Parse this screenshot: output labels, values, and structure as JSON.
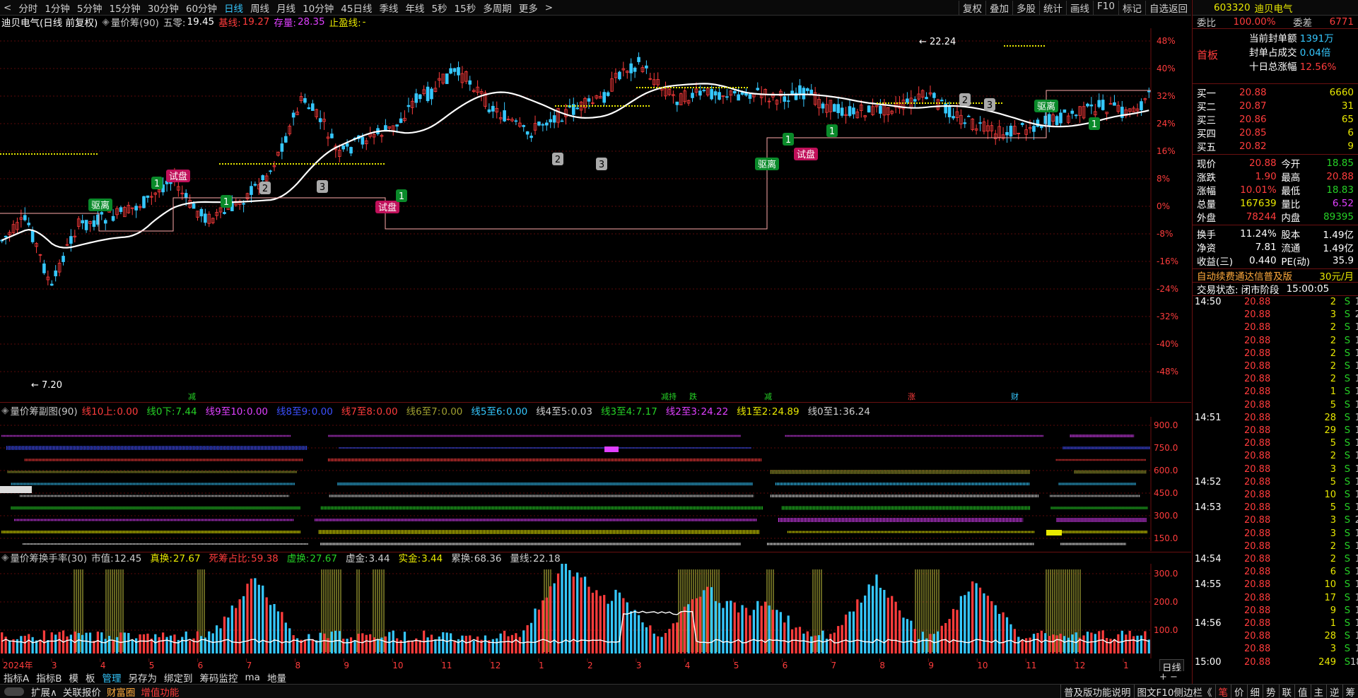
{
  "toolbar": {
    "periods": [
      "分时",
      "1分钟",
      "5分钟",
      "15分钟",
      "30分钟",
      "60分钟",
      "日线",
      "周线",
      "月线",
      "10分钟",
      "45日线",
      "季线",
      "年线",
      "5秒",
      "15秒",
      "多周期",
      "更多"
    ],
    "active": "日线",
    "right": [
      "复权",
      "叠加",
      "多股",
      "统计",
      "画线",
      "F10",
      "标记",
      "自选返回"
    ]
  },
  "main": {
    "stock_name": "迪贝电气(日线 前复权)",
    "indicator": "量价筹(90)",
    "wuling_label": "五零:",
    "wuling": "19.45",
    "jixian_label": "基线:",
    "jixian": "19.27",
    "cunliang_label": "存量:",
    "cunliang": "28.35",
    "zhiying_label": "止盈线:",
    "zhiying": "-",
    "high_label": "22.24",
    "low_label": "7.20",
    "y_axis": [
      "48%",
      "40%",
      "32%",
      "24%",
      "16%",
      "8%",
      "0%",
      "-8%",
      "-16%",
      "-24%",
      "-32%",
      "-40%",
      "-48%"
    ],
    "markers": [
      {
        "t": "驱离"
      },
      {
        "t": "试盘"
      },
      {
        "t": "1"
      },
      {
        "t": "2"
      },
      {
        "t": "3"
      },
      {
        "t": "1"
      },
      {
        "t": "试盘"
      },
      {
        "t": "1"
      },
      {
        "t": "2"
      },
      {
        "t": "3"
      },
      {
        "t": "驱离"
      },
      {
        "t": "1"
      },
      {
        "t": "试盘"
      },
      {
        "t": "1"
      },
      {
        "t": "2"
      },
      {
        "t": "3"
      },
      {
        "t": "驱离"
      },
      {
        "t": "1"
      }
    ],
    "events": [
      "减",
      "减持",
      "跌",
      "减",
      "涨",
      "财"
    ]
  },
  "sub1": {
    "title": "量价筹副图(90)",
    "items": [
      {
        "k": "线10上:",
        "v": "0.00",
        "c": "#ff3c3c"
      },
      {
        "k": "线0下:",
        "v": "7.44",
        "c": "#26d226"
      },
      {
        "k": "线9至10:",
        "v": "0.00",
        "c": "#e040ff"
      },
      {
        "k": "线8至9:",
        "v": "0.00",
        "c": "#3c50ff"
      },
      {
        "k": "线7至8:",
        "v": "0.00",
        "c": "#ff3c3c"
      },
      {
        "k": "线6至7:",
        "v": "0.00",
        "c": "#a0a030"
      },
      {
        "k": "线5至6:",
        "v": "0.00",
        "c": "#35c8ff"
      },
      {
        "k": "线4至5:",
        "v": "0.03",
        "c": "#d0d0d0"
      },
      {
        "k": "线3至4:",
        "v": "7.17",
        "c": "#26d226"
      },
      {
        "k": "线2至3:",
        "v": "24.22",
        "c": "#e040ff"
      },
      {
        "k": "线1至2:",
        "v": "24.89",
        "c": "#e8e800"
      },
      {
        "k": "线0至1:",
        "v": "36.24",
        "c": "#d0d0d0"
      }
    ],
    "y_axis": [
      "900.0",
      "750.0",
      "600.0",
      "450.0",
      "300.0",
      "150.0"
    ]
  },
  "sub2": {
    "title": "量价筹换手率(30)",
    "items": [
      {
        "k": "市值:",
        "v": "12.45",
        "c": "#d0d0d0"
      },
      {
        "k": "真换:",
        "v": "27.67",
        "c": "#e8e800"
      },
      {
        "k": "死筹占比:",
        "v": "59.38",
        "c": "#ff3c3c"
      },
      {
        "k": "虚换:",
        "v": "27.67",
        "c": "#26d226"
      },
      {
        "k": "虚金:",
        "v": "3.44",
        "c": "#d0d0d0"
      },
      {
        "k": "实金:",
        "v": "3.44",
        "c": "#e8e800"
      },
      {
        "k": "累换:",
        "v": "68.36",
        "c": "#d0d0d0"
      },
      {
        "k": "量线:",
        "v": "22.18",
        "c": "#d0d0d0"
      }
    ],
    "y_axis": [
      "300.0",
      "200.0",
      "100.0"
    ]
  },
  "xaxis": [
    "2024年",
    "3",
    "4",
    "5",
    "6",
    "7",
    "8",
    "9",
    "10",
    "11",
    "12",
    "1",
    "2",
    "3",
    "4",
    "5",
    "6",
    "7",
    "8",
    "9",
    "10",
    "11",
    "12",
    "1"
  ],
  "period_label": "日线",
  "tabs": [
    "指标A",
    "指标B",
    "模",
    "板",
    "管理",
    "另存为",
    "绑定到",
    "筹码监控",
    "ma",
    "地量"
  ],
  "bottom_left": [
    "扩展∧",
    "关联报价",
    "财富圈",
    "增值功能"
  ],
  "bottom_right": [
    "普及版功能说明",
    "图文F10侧边栏《",
    "笔",
    "价",
    "细",
    "势",
    "联",
    "值",
    "主",
    "逆",
    "筹"
  ],
  "quote": {
    "code": "603320",
    "name": "迪贝电气",
    "weibi_label": "委比",
    "weibi": "100.00%",
    "weicha_label": "委差",
    "weicha": "6771",
    "shouban": "首板",
    "fengdan_label": "当前封单额",
    "fengdan": "1391万",
    "fengzhan_label": "封单占成交",
    "fengzhan": "0.04倍",
    "shiri_label": "十日总涨幅",
    "shiri": "12.56%",
    "bids": [
      {
        "l": "买一",
        "p": "20.88",
        "v": "6660"
      },
      {
        "l": "买二",
        "p": "20.87",
        "v": "31"
      },
      {
        "l": "买三",
        "p": "20.86",
        "v": "65"
      },
      {
        "l": "买四",
        "p": "20.85",
        "v": "6"
      },
      {
        "l": "买五",
        "p": "20.82",
        "v": "9"
      }
    ],
    "stats": [
      {
        "a": "现价",
        "av": "20.88",
        "ac": "#ff3c3c",
        "b": "今开",
        "bv": "18.85",
        "bc": "#26d226"
      },
      {
        "a": "涨跌",
        "av": "1.90",
        "ac": "#ff3c3c",
        "b": "最高",
        "bv": "20.88",
        "bc": "#ff3c3c"
      },
      {
        "a": "涨幅",
        "av": "10.01%",
        "ac": "#ff3c3c",
        "b": "最低",
        "bv": "18.83",
        "bc": "#26d226"
      },
      {
        "a": "总量",
        "av": "167639",
        "ac": "#e8e800",
        "b": "量比",
        "bv": "6.52",
        "bc": "#e040ff"
      },
      {
        "a": "外盘",
        "av": "78244",
        "ac": "#ff3c3c",
        "b": "内盘",
        "bv": "89395",
        "bc": "#26d226"
      }
    ],
    "stats2": [
      {
        "a": "换手",
        "av": "11.24%",
        "b": "股本",
        "bv": "1.49亿"
      },
      {
        "a": "净资",
        "av": "7.81",
        "b": "流通",
        "bv": "1.49亿"
      },
      {
        "a": "收益(三)",
        "av": "0.440",
        "b": "PE(动)",
        "bv": "35.9"
      }
    ],
    "promo": "自动续费通达信普及版",
    "promo_price": "30元/月",
    "status_label": "交易状态:",
    "status": "闭市阶段",
    "status_time": "15:00:05"
  },
  "ticks": [
    {
      "t": "14:50",
      "p": "20.88",
      "v": "2",
      "s": "S",
      "n": "1"
    },
    {
      "t": "",
      "p": "20.88",
      "v": "3",
      "s": "S",
      "n": "2"
    },
    {
      "t": "",
      "p": "20.88",
      "v": "2",
      "s": "S",
      "n": "1"
    },
    {
      "t": "",
      "p": "20.88",
      "v": "2",
      "s": "S",
      "n": "1"
    },
    {
      "t": "",
      "p": "20.88",
      "v": "2",
      "s": "S",
      "n": "1"
    },
    {
      "t": "",
      "p": "20.88",
      "v": "2",
      "s": "S",
      "n": "1"
    },
    {
      "t": "",
      "p": "20.88",
      "v": "2",
      "s": "S",
      "n": "1"
    },
    {
      "t": "",
      "p": "20.88",
      "v": "1",
      "s": "S",
      "n": "1"
    },
    {
      "t": "",
      "p": "20.88",
      "v": "5",
      "s": "S",
      "n": "1"
    },
    {
      "t": "14:51",
      "p": "20.88",
      "v": "28",
      "s": "S",
      "n": "1"
    },
    {
      "t": "",
      "p": "20.88",
      "v": "29",
      "s": "S",
      "n": "1"
    },
    {
      "t": "",
      "p": "20.88",
      "v": "5",
      "s": "S",
      "n": "1"
    },
    {
      "t": "",
      "p": "20.88",
      "v": "2",
      "s": "S",
      "n": "1"
    },
    {
      "t": "",
      "p": "20.88",
      "v": "3",
      "s": "S",
      "n": "1"
    },
    {
      "t": "14:52",
      "p": "20.88",
      "v": "5",
      "s": "S",
      "n": "1"
    },
    {
      "t": "",
      "p": "20.88",
      "v": "10",
      "s": "S",
      "n": "1"
    },
    {
      "t": "14:53",
      "p": "20.88",
      "v": "5",
      "s": "S",
      "n": "1"
    },
    {
      "t": "",
      "p": "20.88",
      "v": "3",
      "s": "S",
      "n": "2"
    },
    {
      "t": "",
      "p": "20.88",
      "v": "3",
      "s": "S",
      "n": "1"
    },
    {
      "t": "",
      "p": "20.88",
      "v": "2",
      "s": "S",
      "n": "1"
    },
    {
      "t": "14:54",
      "p": "20.88",
      "v": "2",
      "s": "S",
      "n": "1"
    },
    {
      "t": "",
      "p": "20.88",
      "v": "6",
      "s": "S",
      "n": "1"
    },
    {
      "t": "14:55",
      "p": "20.88",
      "v": "10",
      "s": "S",
      "n": "1"
    },
    {
      "t": "",
      "p": "20.88",
      "v": "17",
      "s": "S",
      "n": "1"
    },
    {
      "t": "",
      "p": "20.88",
      "v": "9",
      "s": "S",
      "n": "1"
    },
    {
      "t": "14:56",
      "p": "20.88",
      "v": "1",
      "s": "S",
      "n": "1"
    },
    {
      "t": "",
      "p": "20.88",
      "v": "28",
      "s": "S",
      "n": "1"
    },
    {
      "t": "",
      "p": "20.88",
      "v": "3",
      "s": "S",
      "n": "1"
    },
    {
      "t": "15:00",
      "p": "20.88",
      "v": "249",
      "s": "S",
      "n": "18"
    }
  ],
  "colors": {
    "up": "#ff3c3c",
    "down": "#35c8ff",
    "ma": "#ffffff",
    "grid": "#5a0a0a",
    "chips": "#e8e800"
  }
}
